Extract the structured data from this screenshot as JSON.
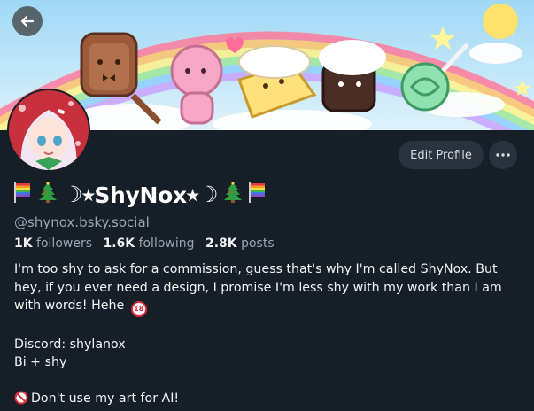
{
  "profile": {
    "display_name": "ShyNox",
    "name_prefix": "☽⭒",
    "name_suffix": "⭒☽",
    "handle": "@shynox.bsky.social",
    "stats": {
      "followers_count": "1K",
      "followers_label": "followers",
      "following_count": "1.6K",
      "following_label": "following",
      "posts_count": "2.8K",
      "posts_label": "posts"
    },
    "bio": {
      "paragraph1": "I'm too shy to ask for a commission, guess that's why I'm called ShyNox. But hey, if you ever need a design, I promise I'm less shy with my work than I am with words! Hehe",
      "badge": "18",
      "discord": "Discord: shylanox",
      "identity": "Bi + shy",
      "ai_notice": "Don't use my art for AI!"
    }
  },
  "actions": {
    "edit_profile_label": "Edit Profile"
  },
  "icons": {
    "back": "back-arrow-icon",
    "more": "more-dots-icon",
    "flag": "rainbow-flag-icon",
    "tree": "christmas-tree-icon",
    "prohibited": "no-entry-icon"
  },
  "colors": {
    "background": "#161e27",
    "button": "#29323d",
    "muted_text": "#9aa5b2"
  }
}
